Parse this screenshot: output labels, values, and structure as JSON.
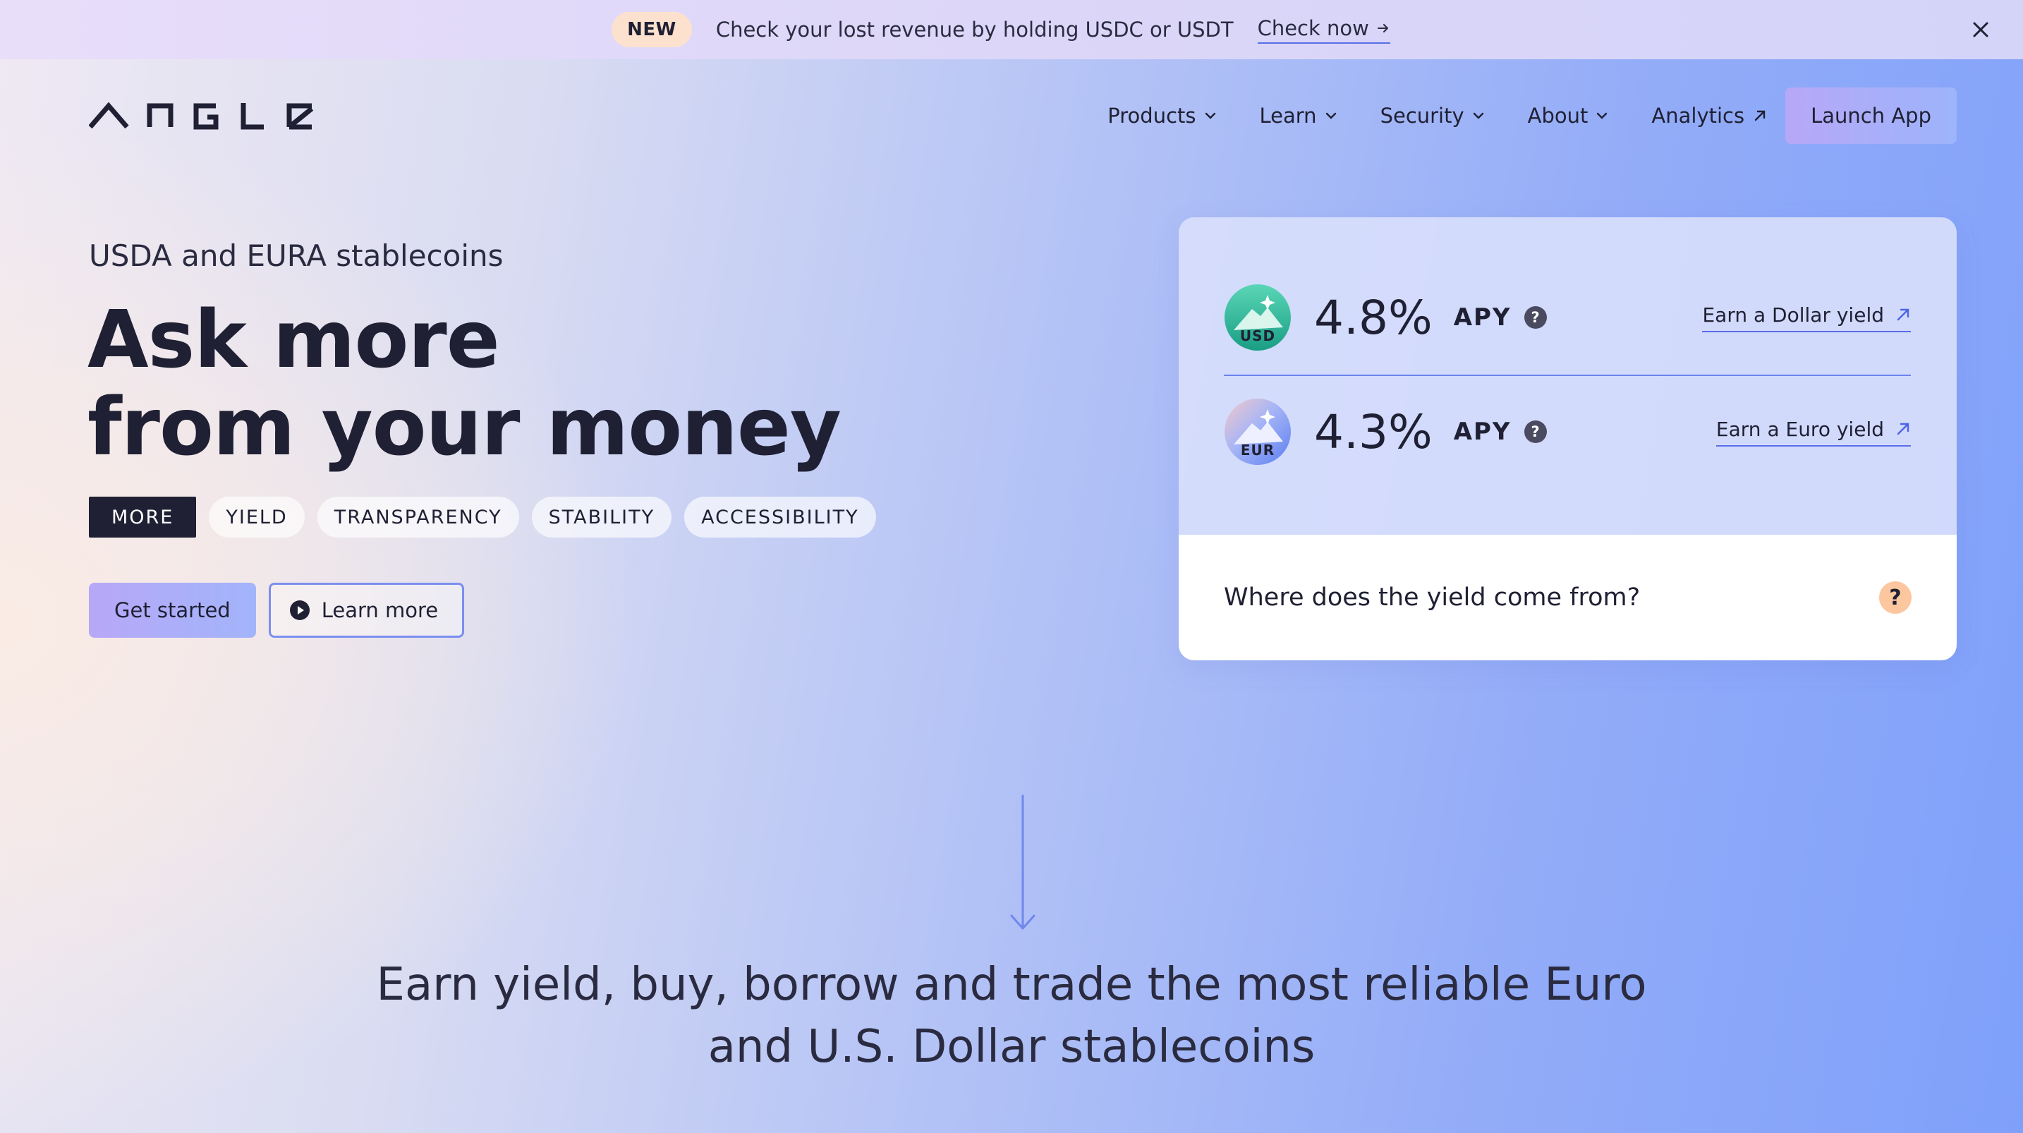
{
  "banner": {
    "badge": "NEW",
    "message": "Check your lost revenue by holding USDC or USDT",
    "link_label": "Check now",
    "link_icon": "arrow-right-icon",
    "close_icon": "close-icon"
  },
  "header": {
    "logo_text": "ANGLE",
    "nav": [
      {
        "label": "Products",
        "icon": "chevron-down-icon"
      },
      {
        "label": "Learn",
        "icon": "chevron-down-icon"
      },
      {
        "label": "Security",
        "icon": "chevron-down-icon"
      },
      {
        "label": "About",
        "icon": "chevron-down-icon"
      },
      {
        "label": "Analytics",
        "icon": "external-arrow-icon"
      }
    ],
    "launch_label": "Launch App"
  },
  "hero": {
    "eyebrow": "USDA and EURA stablecoins",
    "headline_line1": "Ask more",
    "headline_line2": "from your money",
    "pills": [
      "MORE",
      "YIELD",
      "TRANSPARENCY",
      "STABILITY",
      "ACCESSIBILITY"
    ],
    "active_pill": "MORE",
    "primary_cta": "Get started",
    "secondary_cta": "Learn more"
  },
  "yield_card": {
    "rows": [
      {
        "coin": "USD",
        "apy": "4.8%",
        "apy_label": "APY",
        "help": "?",
        "link": "Earn a Dollar yield"
      },
      {
        "coin": "EUR",
        "apy": "4.3%",
        "apy_label": "APY",
        "help": "?",
        "link": "Earn a Euro yield"
      }
    ],
    "faq_question": "Where does the yield come from?",
    "faq_icon": "?"
  },
  "tagline": {
    "line1": "Earn yield, buy, borrow and trade the most reliable Euro",
    "line2": "and U.S. Dollar stablecoins"
  },
  "colors": {
    "text_dark": "#1f2033",
    "accent_blue": "#5a6ee8",
    "button_gradient_start": "#b7a8f7",
    "faq_icon_bg": "#fcc79f",
    "new_badge_bg": "#fde1cf"
  }
}
